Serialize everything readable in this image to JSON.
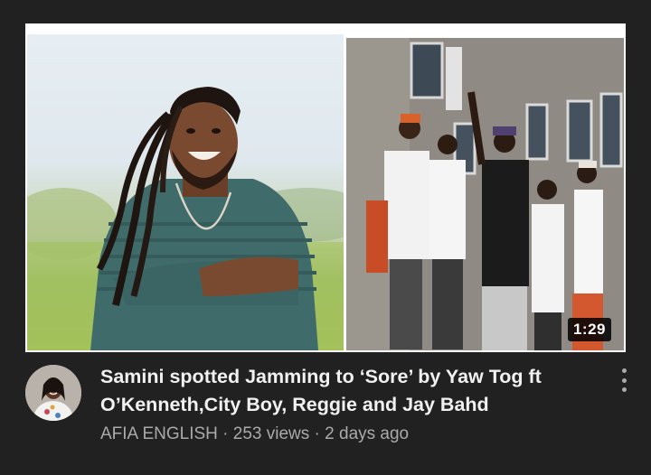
{
  "video": {
    "duration": "1:29",
    "title": "Samini spotted Jamming to ‘Sore’ by Yaw Tog ft O’Kenneth,City Boy, Reggie and Jay Bahd",
    "channel": "AFIA ENGLISH",
    "views": "253 views",
    "age": "2 days ago",
    "separator": "·"
  },
  "icons": {
    "menu": "more-vert-icon"
  }
}
